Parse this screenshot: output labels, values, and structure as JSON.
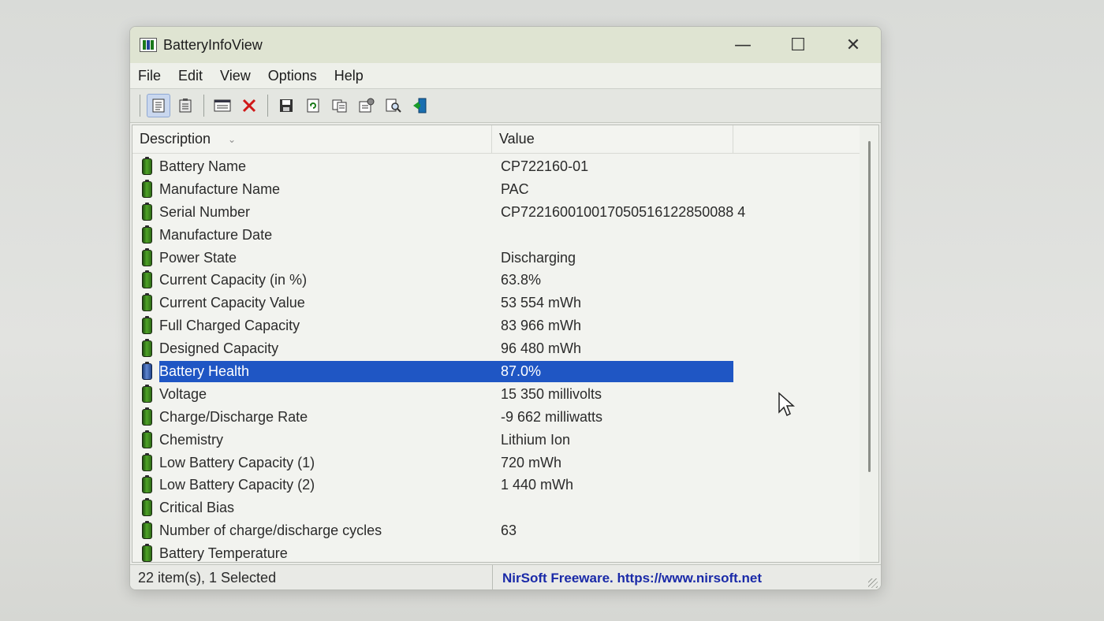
{
  "window": {
    "title": "BatteryInfoView",
    "minimize_icon": "—",
    "maximize_icon": "☐",
    "close_icon": "✕"
  },
  "menu": [
    "File",
    "Edit",
    "View",
    "Options",
    "Help"
  ],
  "toolbar": {
    "buttons": [
      "report-view-icon",
      "html-report-icon",
      "properties-window-icon",
      "delete-icon",
      "save-icon",
      "refresh-icon",
      "copy-icon",
      "options-icon",
      "find-icon",
      "exit-icon"
    ]
  },
  "list": {
    "columns": {
      "description": "Description",
      "value": "Value",
      "sort_indicator": "⌄"
    },
    "rows": [
      {
        "description": "Battery Name",
        "value": "CP722160-01"
      },
      {
        "description": "Manufacture Name",
        "value": "PAC"
      },
      {
        "description": "Serial Number",
        "value": "CP722160010017050516122850088 4"
      },
      {
        "description": "Manufacture Date",
        "value": ""
      },
      {
        "description": "Power State",
        "value": "Discharging"
      },
      {
        "description": "Current Capacity (in %)",
        "value": "63.8%"
      },
      {
        "description": "Current Capacity Value",
        "value": "53 554 mWh"
      },
      {
        "description": "Full Charged Capacity",
        "value": "83 966 mWh"
      },
      {
        "description": "Designed Capacity",
        "value": "96 480 mWh"
      },
      {
        "description": "Battery Health",
        "value": "87.0%",
        "selected": true
      },
      {
        "description": "Voltage",
        "value": "15 350 millivolts"
      },
      {
        "description": "Charge/Discharge Rate",
        "value": "-9 662 milliwatts"
      },
      {
        "description": "Chemistry",
        "value": "Lithium Ion"
      },
      {
        "description": "Low Battery Capacity (1)",
        "value": "720 mWh"
      },
      {
        "description": "Low Battery Capacity (2)",
        "value": "1 440 mWh"
      },
      {
        "description": "Critical Bias",
        "value": ""
      },
      {
        "description": "Number of charge/discharge cycles",
        "value": "63"
      },
      {
        "description": "Battery Temperature",
        "value": ""
      }
    ]
  },
  "status": {
    "left": "22 item(s), 1 Selected",
    "right": "NirSoft Freeware. https://www.nirsoft.net"
  },
  "colors": {
    "selection": "#1f56c4",
    "link": "#1a2aa8",
    "battery_green": "#4ea326"
  }
}
